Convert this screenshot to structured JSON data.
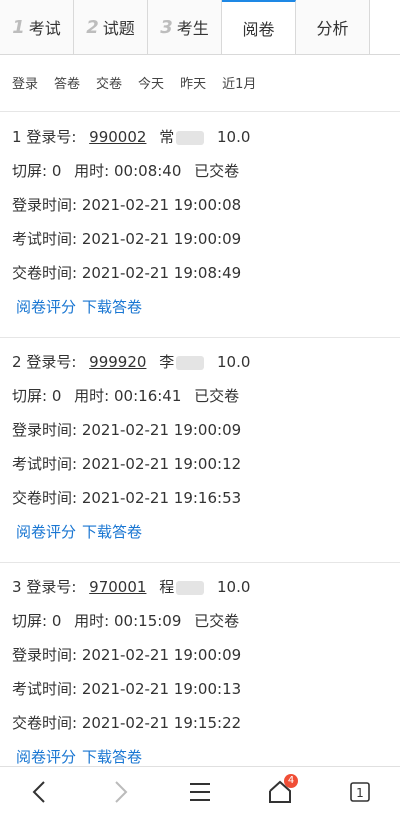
{
  "tabs": [
    {
      "num": "1",
      "label": "考试"
    },
    {
      "num": "2",
      "label": "试题"
    },
    {
      "num": "3",
      "label": "考生"
    },
    {
      "num": "",
      "label": "阅卷"
    },
    {
      "num": "",
      "label": "分析"
    }
  ],
  "filters": [
    "登录",
    "答卷",
    "交卷",
    "今天",
    "昨天",
    "近1月"
  ],
  "labels": {
    "login_no": "登录号:",
    "switch_screen": "切屏:",
    "time_used": "用时:",
    "login_time": "登录时间:",
    "exam_time": "考试时间:",
    "submit_time": "交卷时间:",
    "grade_link": "阅卷评分",
    "download_link": "下载答卷"
  },
  "records": [
    {
      "index": "1",
      "login_id": "990002",
      "name_prefix": "常",
      "score": "10.0",
      "switch_count": "0",
      "duration": "00:08:40",
      "status": "已交卷",
      "login_time": "2021-02-21 19:00:08",
      "exam_time": "2021-02-21 19:00:09",
      "submit_time": "2021-02-21 19:08:49"
    },
    {
      "index": "2",
      "login_id": "999920",
      "name_prefix": "李",
      "score": "10.0",
      "switch_count": "0",
      "duration": "00:16:41",
      "status": "已交卷",
      "login_time": "2021-02-21 19:00:09",
      "exam_time": "2021-02-21 19:00:12",
      "submit_time": "2021-02-21 19:16:53"
    },
    {
      "index": "3",
      "login_id": "970001",
      "name_prefix": "程",
      "score": "10.0",
      "switch_count": "0",
      "duration": "00:15:09",
      "status": "已交卷",
      "login_time": "2021-02-21 19:00:09",
      "exam_time": "2021-02-21 19:00:13",
      "submit_time": "2021-02-21 19:15:22"
    }
  ],
  "bottom_bar": {
    "icons": [
      "back-icon",
      "forward-icon",
      "menu-icon",
      "home-icon",
      "tabs-icon"
    ],
    "home_badge": "4",
    "tabs_count": "1"
  }
}
